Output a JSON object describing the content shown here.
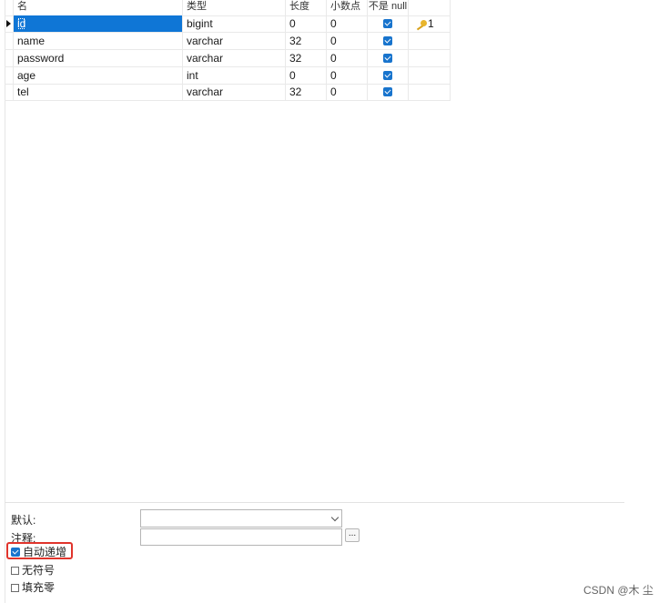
{
  "table": {
    "headers": [
      "名",
      "类型",
      "长度",
      "小数点",
      "不是 null",
      ""
    ],
    "rows": [
      {
        "name": "id",
        "type": "bigint",
        "length": "0",
        "decimals": "0",
        "not_null": true,
        "key": "1",
        "selected": true
      },
      {
        "name": "name",
        "type": "varchar",
        "length": "32",
        "decimals": "0",
        "not_null": true,
        "key": "",
        "selected": false
      },
      {
        "name": "password",
        "type": "varchar",
        "length": "32",
        "decimals": "0",
        "not_null": true,
        "key": "",
        "selected": false
      },
      {
        "name": "age",
        "type": "int",
        "length": "0",
        "decimals": "0",
        "not_null": true,
        "key": "",
        "selected": false
      },
      {
        "name": "tel",
        "type": "varchar",
        "length": "32",
        "decimals": "0",
        "not_null": true,
        "key": "",
        "selected": false
      }
    ],
    "selection_color": "#0f76d6",
    "checkbox_color": "#1874cd"
  },
  "properties": {
    "default_label": "默认:",
    "default_value": "",
    "comment_label": "注释:",
    "comment_value": "",
    "ellipsis_label": "...",
    "auto_increment_label": "自动递增",
    "auto_increment_checked": true,
    "unsigned_label": "无符号",
    "unsigned_checked": false,
    "zerofill_label": "填充零",
    "zerofill_checked": false,
    "highlight_color": "#e0342c"
  },
  "watermark": "CSDN @木 尘"
}
